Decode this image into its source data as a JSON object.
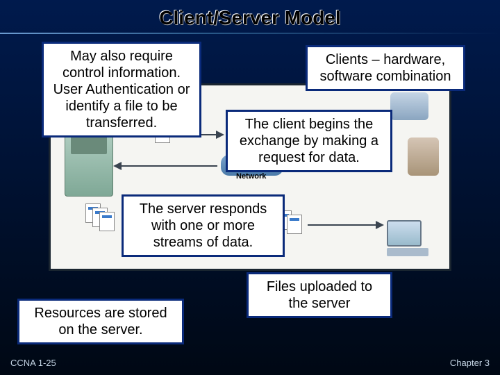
{
  "title": "Client/Server Model",
  "network_label": "Network",
  "callouts": {
    "control_info": "May also require control information. User Authentication or identify a file to be transferred.",
    "clients_hw_sw": "Clients – hardware, software combination",
    "client_begins": "The client begins the exchange by making a request for data.",
    "server_responds": "The server responds with one or more streams of data.",
    "files_uploaded": "Files uploaded to the server",
    "resources_stored": "Resources are stored on the server."
  },
  "footer": {
    "left": "CCNA 1-25",
    "right": "Chapter 3"
  }
}
